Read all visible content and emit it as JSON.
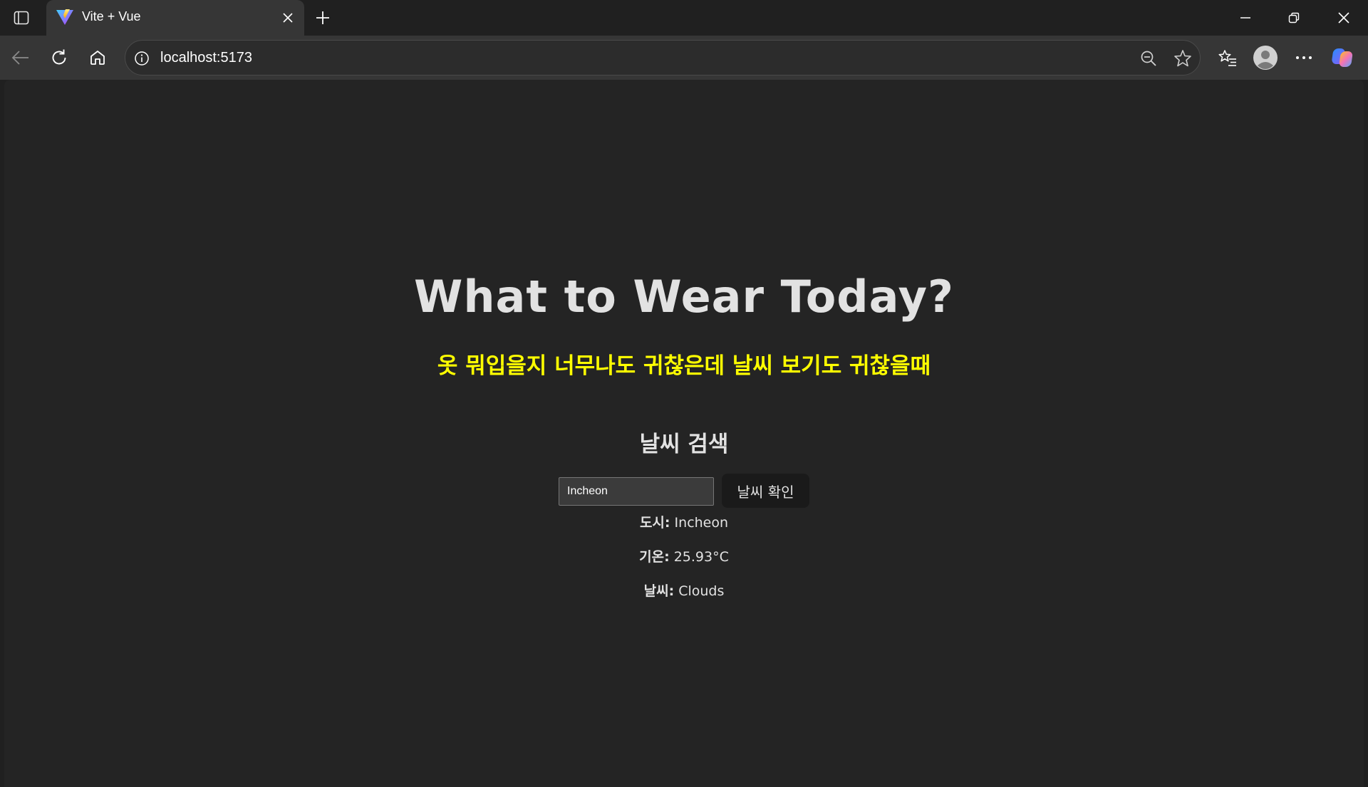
{
  "browser": {
    "tab": {
      "title": "Vite + Vue"
    },
    "address": {
      "url": "localhost:5173"
    }
  },
  "page": {
    "title": "What to Wear Today?",
    "subtitle": "옷 뭐입을지 너무나도 귀찮은데 날씨 보기도 귀찮을때",
    "search": {
      "heading": "날씨 검색",
      "input_value": "Incheon",
      "button_label": "날씨 확인"
    },
    "result": {
      "city_label": "도시:",
      "city_value": "Incheon",
      "temp_label": "기온:",
      "temp_value": "25.93°C",
      "weather_label": "날씨:",
      "weather_value": "Clouds"
    }
  },
  "colors": {
    "subtitle": "#ffff00",
    "background": "#242424",
    "button_bg": "#1a1a1a"
  }
}
